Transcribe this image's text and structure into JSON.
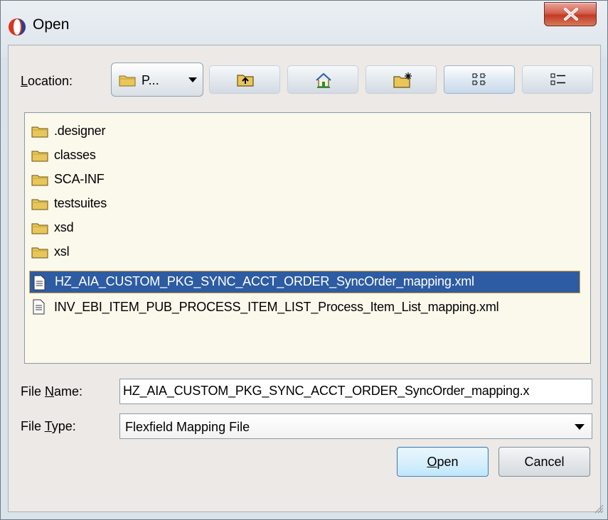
{
  "window": {
    "title": "Open",
    "close_icon": "close-icon"
  },
  "toolbar": {
    "location_label_underlined": "L",
    "location_label_rest": "ocation:",
    "location_value": "P...",
    "buttons": [
      {
        "name": "up-one-level-button",
        "icon": "folder-up-icon"
      },
      {
        "name": "home-button",
        "icon": "home-icon"
      },
      {
        "name": "new-folder-button",
        "icon": "new-folder-icon"
      },
      {
        "name": "list-view-button",
        "icon": "list-view-icon",
        "active": true
      },
      {
        "name": "details-view-button",
        "icon": "details-view-icon"
      }
    ]
  },
  "files": [
    {
      "name": ".designer",
      "type": "folder"
    },
    {
      "name": "classes",
      "type": "folder"
    },
    {
      "name": "SCA-INF",
      "type": "folder"
    },
    {
      "name": "testsuites",
      "type": "folder"
    },
    {
      "name": "xsd",
      "type": "folder"
    },
    {
      "name": "xsl",
      "type": "folder"
    },
    {
      "name": "HZ_AIA_CUSTOM_PKG_SYNC_ACCT_ORDER_SyncOrder_mapping.xml",
      "type": "file",
      "selected": true
    },
    {
      "name": "INV_EBI_ITEM_PUB_PROCESS_ITEM_LIST_Process_Item_List_mapping.xml",
      "type": "file"
    }
  ],
  "file_name": {
    "label_pre": "File ",
    "label_underlined": "N",
    "label_post": "ame:",
    "value": "HZ_AIA_CUSTOM_PKG_SYNC_ACCT_ORDER_SyncOrder_mapping.x"
  },
  "file_type": {
    "label_pre": "File ",
    "label_underlined": "T",
    "label_post": "ype:",
    "value": "Flexfield Mapping File"
  },
  "buttons": {
    "open_underlined": "O",
    "open_rest": "pen",
    "cancel": "Cancel"
  },
  "colors": {
    "selection": "#2d5ca2",
    "list_background": "#fbf8ec",
    "folder": "#e8c65a"
  }
}
